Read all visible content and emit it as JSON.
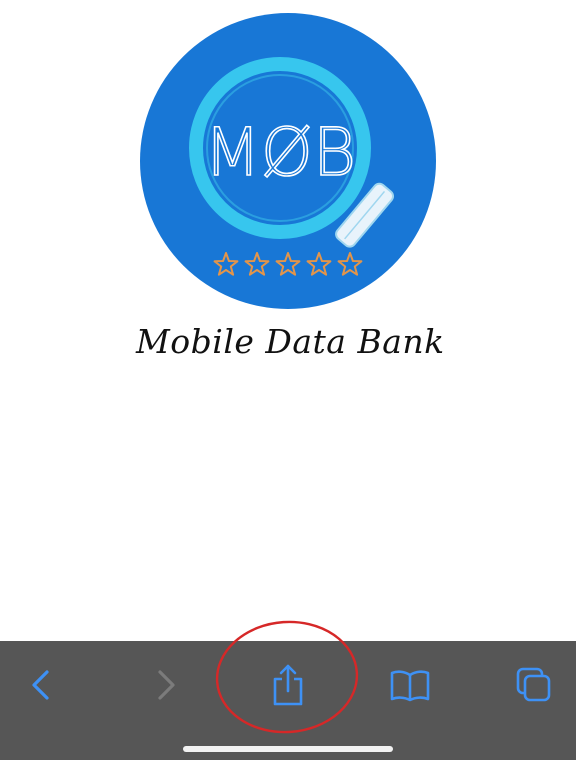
{
  "logo": {
    "letters": "MØB",
    "stars_total": 5,
    "colors": {
      "background": "#1877d6",
      "ring": "#37c6ee",
      "star": "#e3954a"
    }
  },
  "tagline": "Mobile Data Bank",
  "toolbar": {
    "back_icon": "chevron-left-icon",
    "forward_icon": "chevron-right-icon",
    "share_icon": "share-icon",
    "bookmarks_icon": "book-open-icon",
    "tabs_icon": "tabs-icon",
    "colors": {
      "background": "#565656",
      "active_icon": "#3e91f5",
      "disabled_icon": "#7b7b7b",
      "annotation": "#d62828"
    }
  }
}
